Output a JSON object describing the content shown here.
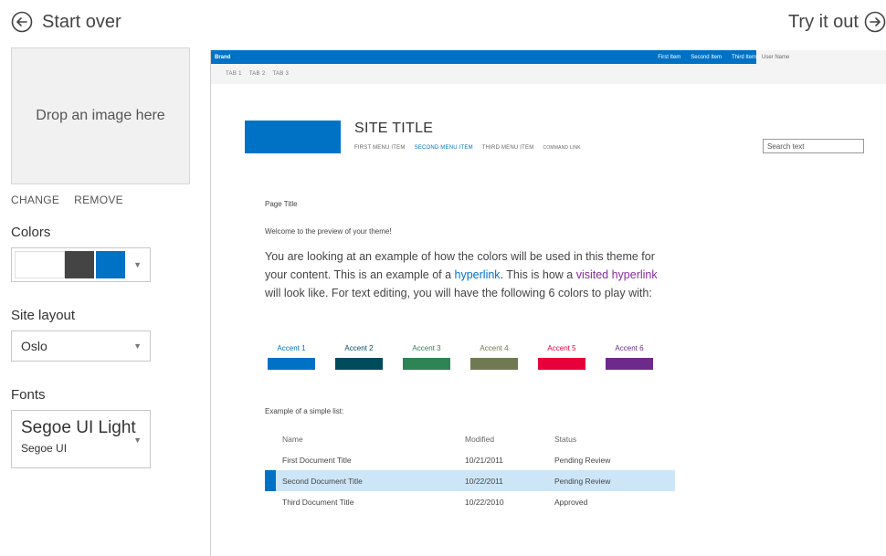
{
  "nav": {
    "back_label": "Start over",
    "forward_label": "Try it out",
    "back_icon": "circle-arrow-left-icon",
    "forward_icon": "circle-arrow-right-icon"
  },
  "left_panel": {
    "drop_zone_text": "Drop an image here",
    "change_label": "CHANGE",
    "remove_label": "REMOVE",
    "colors_label": "Colors",
    "color_swatches": [
      "#ffffff",
      "#444444",
      "#0072c6"
    ],
    "site_layout_label": "Site layout",
    "site_layout_value": "Oslo",
    "fonts_label": "Fonts",
    "font_heading": "Segoe UI Light",
    "font_body": "Segoe UI"
  },
  "preview": {
    "suite_bar": {
      "brand": "Brand",
      "items": [
        "First Item",
        "Second Item",
        "Third Item"
      ],
      "user": "User Name"
    },
    "tabs": [
      "TAB 1",
      "TAB 2",
      "TAB 3"
    ],
    "site_title": "SITE TITLE",
    "menu_items": [
      "FIRST MENU ITEM",
      "SECOND MENU ITEM",
      "THIRD MENU ITEM",
      "COMMAND LINK"
    ],
    "active_menu_index": 1,
    "search_placeholder": "Search text",
    "page_title": "Page Title",
    "welcome": "Welcome to the preview of your theme!",
    "body_text": {
      "part1": "You are looking at an example of how the colors will be used in this theme for your content. This is an example of a ",
      "link": "hyperlink",
      "part2": ". This is how a ",
      "visited_link": "visited hyperlink",
      "part3": " will look like. For text editing, you will have the following 6 colors to play with:"
    },
    "accents": [
      {
        "label": "Accent 1",
        "color": "#0072c6",
        "text_color": "#0072c6"
      },
      {
        "label": "Accent 2",
        "color": "#004b5c",
        "text_color": "#004b5c"
      },
      {
        "label": "Accent 3",
        "color": "#2d8454",
        "text_color": "#2d8454"
      },
      {
        "label": "Accent 4",
        "color": "#6f7a52",
        "text_color": "#6f7a52"
      },
      {
        "label": "Accent 5",
        "color": "#e8003a",
        "text_color": "#e8003a"
      },
      {
        "label": "Accent 6",
        "color": "#6e2a8a",
        "text_color": "#6e2a8a"
      }
    ],
    "list_label": "Example of a simple list:",
    "list_headers": [
      "Name",
      "Modified",
      "Status"
    ],
    "list_rows": [
      {
        "name": "First Document Title",
        "modified": "10/21/2011",
        "status": "Pending Review"
      },
      {
        "name": "Second Document Title",
        "modified": "10/22/2011",
        "status": "Pending Review"
      },
      {
        "name": "Third Document Title",
        "modified": "10/22/2010",
        "status": "Approved"
      }
    ],
    "selected_row_index": 1
  }
}
